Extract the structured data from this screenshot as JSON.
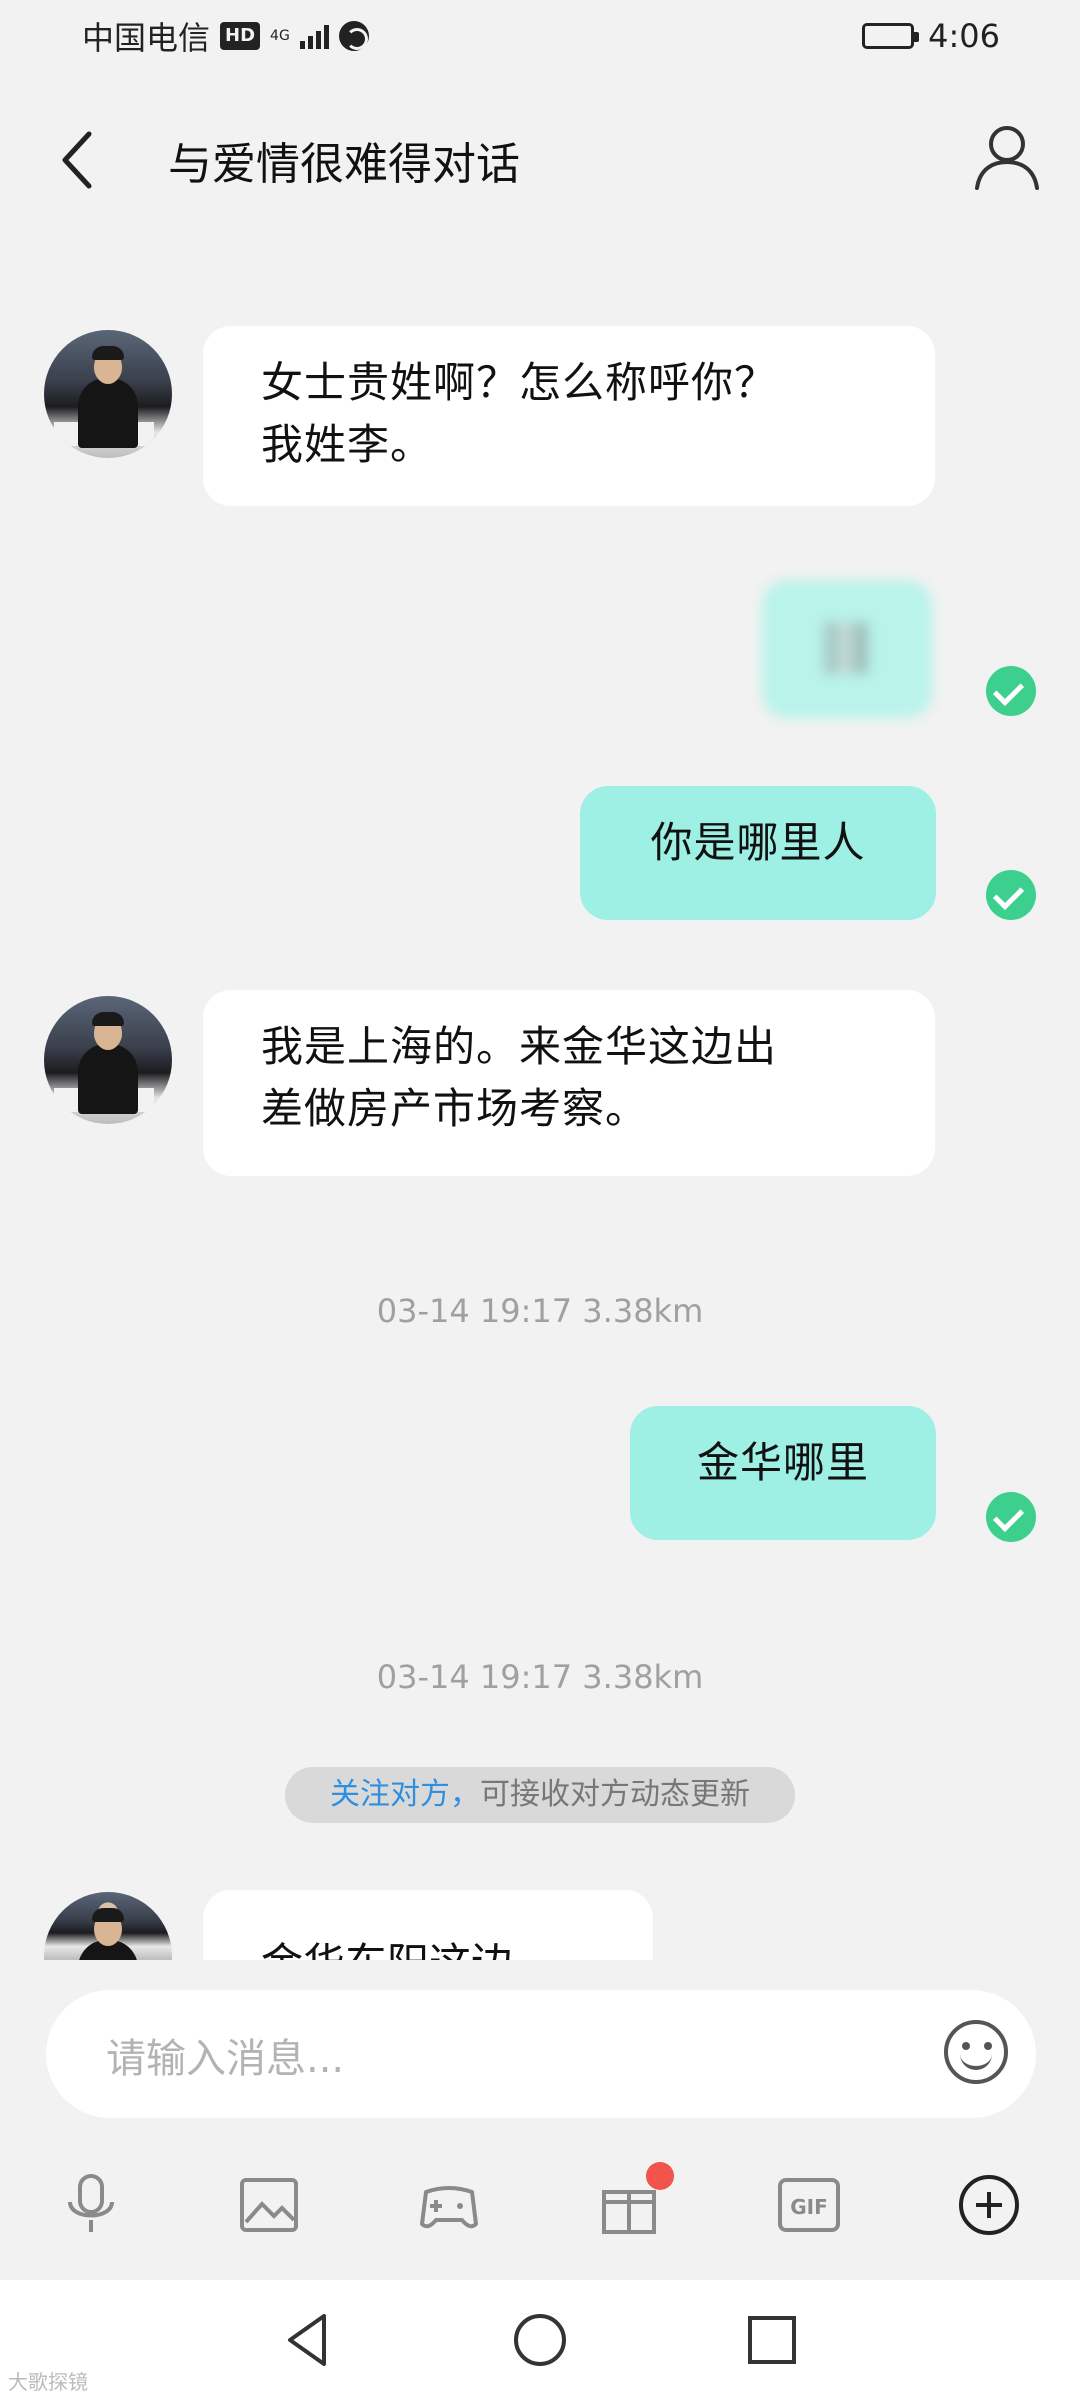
{
  "status_bar": {
    "carrier": "中国电信",
    "hd": "HD",
    "network": "4G",
    "time": "4:06"
  },
  "header": {
    "title": "与爱情很难得对话",
    "back_icon": "chevron-left-icon",
    "profile_icon": "person-icon"
  },
  "messages": [
    {
      "side": "in",
      "text_lines": [
        "女士贵姓啊？怎么称呼你？",
        "我姓李。"
      ]
    },
    {
      "side": "out",
      "text": "[blurred]",
      "status": "read"
    },
    {
      "side": "out",
      "text": "你是哪里人",
      "status": "read"
    },
    {
      "side": "in",
      "text_lines": [
        "我是上海的。来金华这边出",
        "差做房产市场考察。"
      ]
    },
    {
      "side": "meta",
      "text": "03-14 19:17  3.38km"
    },
    {
      "side": "out",
      "text": "金华哪里",
      "status": "read"
    },
    {
      "side": "meta",
      "text": "03-14 19:17  3.38km"
    },
    {
      "side": "in",
      "text": "金华东阳这边"
    }
  ],
  "notice": {
    "link": "关注对方，",
    "text": "可接收对方动态更新"
  },
  "input": {
    "placeholder": "请输入消息..."
  },
  "toolbar": [
    "mic-icon",
    "image-icon",
    "gamepad-icon",
    "gift-icon",
    "gif-icon",
    "plus-icon"
  ],
  "colors": {
    "outgoing_bubble": "#9eefe4",
    "incoming_bubble": "#ffffff",
    "check": "#3ccf8e",
    "link": "#2e8fe0",
    "badge": "#f0544a"
  },
  "watermark": "大歌探镜"
}
